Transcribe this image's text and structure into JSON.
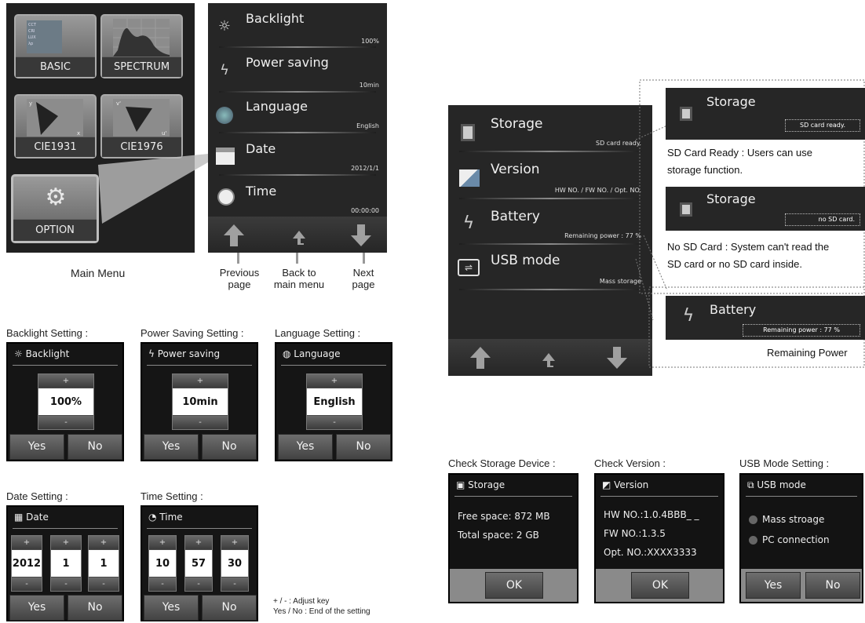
{
  "main_menu": {
    "tiles": [
      "BASIC",
      "SPECTRUM",
      "CIE1931",
      "CIE1976",
      "OPTION"
    ],
    "basic_thumb_rows": [
      "CCT",
      "CRI",
      "LUX",
      "λp"
    ],
    "caption": "Main Menu"
  },
  "option_list": {
    "rows": [
      {
        "title": "Backlight",
        "value": "100%"
      },
      {
        "title": "Power saving",
        "value": "10min"
      },
      {
        "title": "Language",
        "value": "English"
      },
      {
        "title": "Date",
        "value": "2012/1/1"
      },
      {
        "title": "Time",
        "value": "00:00:00"
      }
    ],
    "nav_labels": {
      "prev_line1": "Previous",
      "prev_line2": "page",
      "back_line1": "Back to",
      "back_line2": "main menu",
      "next_line1": "Next",
      "next_line2": "page"
    }
  },
  "settings": {
    "backlight": {
      "caption": "Backlight Setting :",
      "title": "Backlight",
      "value": "100%"
    },
    "power": {
      "caption": "Power Saving Setting :",
      "title": "Power saving",
      "value": "10min"
    },
    "language": {
      "caption": "Language Setting :",
      "title": "Language",
      "value": "English"
    },
    "date": {
      "caption": "Date Setting :",
      "title": "Date",
      "values": [
        "2012",
        "1",
        "1"
      ]
    },
    "time": {
      "caption": "Time Setting :",
      "title": "Time",
      "values": [
        "10",
        "57",
        "30"
      ]
    },
    "plus": "+",
    "minus": "-",
    "yes": "Yes",
    "no": "No",
    "legend_line1": "+ / - : Adjust key",
    "legend_line2": "Yes / No : End of the setting"
  },
  "system_list": {
    "rows": [
      {
        "title": "Storage",
        "value": "SD card ready."
      },
      {
        "title": "Version",
        "value": "HW NO. / FW NO. / Opt. NO."
      },
      {
        "title": "Battery",
        "value": "Remaining power : 77 %"
      },
      {
        "title": "USB mode",
        "value": "Mass storage"
      }
    ]
  },
  "callouts": {
    "storage_ready": {
      "title": "Storage",
      "value": "SD card ready.",
      "desc_line1": "SD Card Ready : Users can use",
      "desc_line2": "storage function."
    },
    "storage_none": {
      "title": "Storage",
      "value": "no SD card.",
      "desc_line1": "No SD Card : System can't read  the",
      "desc_line2": "SD card or no SD card inside."
    },
    "battery": {
      "title": "Battery",
      "value": "Remaining power : 77 %",
      "desc": "Remaining Power"
    }
  },
  "checks": {
    "storage": {
      "caption": "Check Storage Device :",
      "title": "Storage",
      "lines": [
        "Free space: 872 MB",
        "Total space: 2 GB"
      ],
      "ok": "OK"
    },
    "version": {
      "caption": "Check Version :",
      "title": "Version",
      "lines": [
        "HW NO.:1.0.4BBB_ _",
        "FW NO.:1.3.5",
        "Opt. NO.:XXXX3333"
      ],
      "ok": "OK"
    },
    "usb": {
      "caption": "USB Mode Setting :",
      "title": "USB mode",
      "options": [
        "Mass stroage",
        "PC connection"
      ],
      "yes": "Yes",
      "no": "No"
    }
  },
  "colors": {
    "panel_bg": "#1e1e1e",
    "button_gray": "#5a5a5a",
    "accent_arrow": "#8a8a8a"
  }
}
